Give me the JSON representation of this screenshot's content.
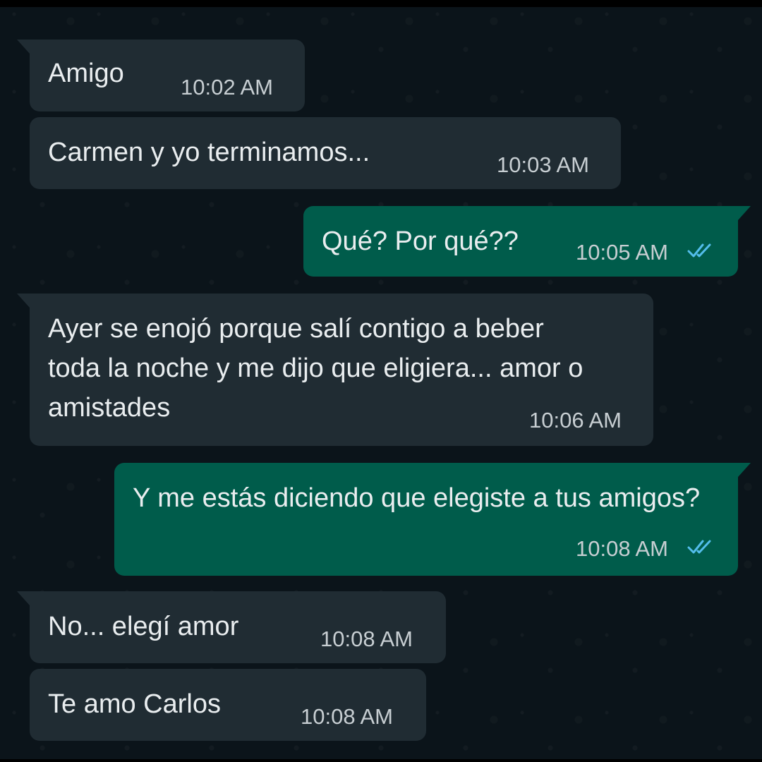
{
  "chat": {
    "messages": [
      {
        "direction": "incoming",
        "text": "Amigo",
        "time": "10:02 AM"
      },
      {
        "direction": "incoming",
        "text": "Carmen y yo terminamos...",
        "time": "10:03 AM"
      },
      {
        "direction": "outgoing",
        "text": "Qué? Por qué??",
        "time": "10:05 AM",
        "status": "read"
      },
      {
        "direction": "incoming",
        "text": "Ayer se enojó porque salí contigo a beber toda la noche y me dijo que eligiera... amor o amistades",
        "time": "10:06 AM"
      },
      {
        "direction": "outgoing",
        "text": "Y me estás diciendo que elegiste a tus amigos?",
        "time": "10:08 AM",
        "status": "read"
      },
      {
        "direction": "incoming",
        "text": "No... elegí amor",
        "time": "10:08 AM"
      },
      {
        "direction": "incoming",
        "text": "Te amo Carlos",
        "time": "10:08 AM"
      }
    ]
  },
  "colors": {
    "background": "#0b141a",
    "incoming_bubble": "#202c33",
    "outgoing_bubble": "#005c4b",
    "read_ticks": "#53bdeb"
  }
}
